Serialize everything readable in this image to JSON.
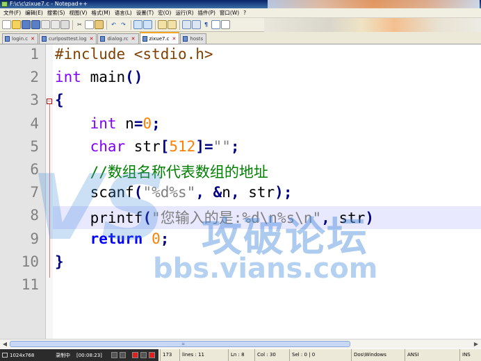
{
  "window": {
    "title": "F:\\c\\c\\zixue7.c - Notepad++"
  },
  "menu": [
    "文件(F)",
    "编辑(E)",
    "搜索(S)",
    "视图(V)",
    "格式(M)",
    "语言(L)",
    "设置(T)",
    "宏(O)",
    "运行(R)",
    "插件(P)",
    "窗口(W)",
    "?"
  ],
  "tabs": [
    {
      "label": "login.c",
      "active": false
    },
    {
      "label": "curlposttest.log",
      "active": false
    },
    {
      "label": "dialog.rc",
      "active": false
    },
    {
      "label": "zixue7.c",
      "active": true
    },
    {
      "label": "hosts",
      "active": false
    }
  ],
  "editor": {
    "line_numbers": [
      "1",
      "2",
      "3",
      "4",
      "5",
      "6",
      "7",
      "8",
      "9",
      "10",
      "11"
    ],
    "lines": [
      [
        [
          "k-pp",
          "#include <stdio.h>"
        ]
      ],
      [
        [
          "k-typ",
          "int"
        ],
        [
          "k-id",
          " main"
        ],
        [
          "k-op",
          "()"
        ]
      ],
      [
        [
          "k-op",
          "{"
        ]
      ],
      [
        [
          "k-id",
          "    "
        ],
        [
          "k-typ",
          "int"
        ],
        [
          "k-id",
          " n"
        ],
        [
          "k-op",
          "="
        ],
        [
          "k-num",
          "0"
        ],
        [
          "k-op",
          ";"
        ]
      ],
      [
        [
          "k-id",
          "    "
        ],
        [
          "k-typ",
          "char"
        ],
        [
          "k-id",
          " str"
        ],
        [
          "k-op",
          "["
        ],
        [
          "k-num",
          "512"
        ],
        [
          "k-op",
          "]="
        ],
        [
          "k-str",
          "\"\""
        ],
        [
          "k-op",
          ";"
        ]
      ],
      [
        [
          "k-id",
          "    "
        ],
        [
          "k-cmt",
          "//数组名称代表数组的地址"
        ]
      ],
      [
        [
          "k-id",
          "    scanf"
        ],
        [
          "k-op",
          "("
        ],
        [
          "k-str",
          "\"%d%s\""
        ],
        [
          "k-op",
          ","
        ],
        [
          "k-id",
          " "
        ],
        [
          "k-op",
          "&"
        ],
        [
          "k-id",
          "n"
        ],
        [
          "k-op",
          ","
        ],
        [
          "k-id",
          " str"
        ],
        [
          "k-op",
          ");"
        ]
      ],
      [
        [
          "k-id",
          "    printf"
        ],
        [
          "k-op",
          "("
        ],
        [
          "k-str",
          "\"您输入的是:%d\\n%s\\n\""
        ],
        [
          "k-op",
          ","
        ],
        [
          "k-id",
          " str"
        ],
        [
          "k-op",
          ")"
        ]
      ],
      [
        [
          "k-id",
          "    "
        ],
        [
          "k-kw",
          "return"
        ],
        [
          "k-id",
          " "
        ],
        [
          "k-num",
          "0"
        ],
        [
          "k-op",
          ";"
        ]
      ],
      [
        [
          "k-op",
          "}"
        ]
      ],
      []
    ]
  },
  "watermark": {
    "logo": "VS",
    "site_cn": "攻破论坛",
    "url": "bbs.vians.com"
  },
  "recorder": {
    "resolution": "1024x768",
    "label": "录制中",
    "elapsed": "[00:08:23]"
  },
  "status": {
    "length": "173",
    "lines": "lines : 11",
    "ln": "Ln : 8",
    "col": "Col : 30",
    "sel": "Sel : 0 | 0",
    "eol": "Dos\\Windows",
    "encoding": "ANSI",
    "mode": "INS"
  }
}
